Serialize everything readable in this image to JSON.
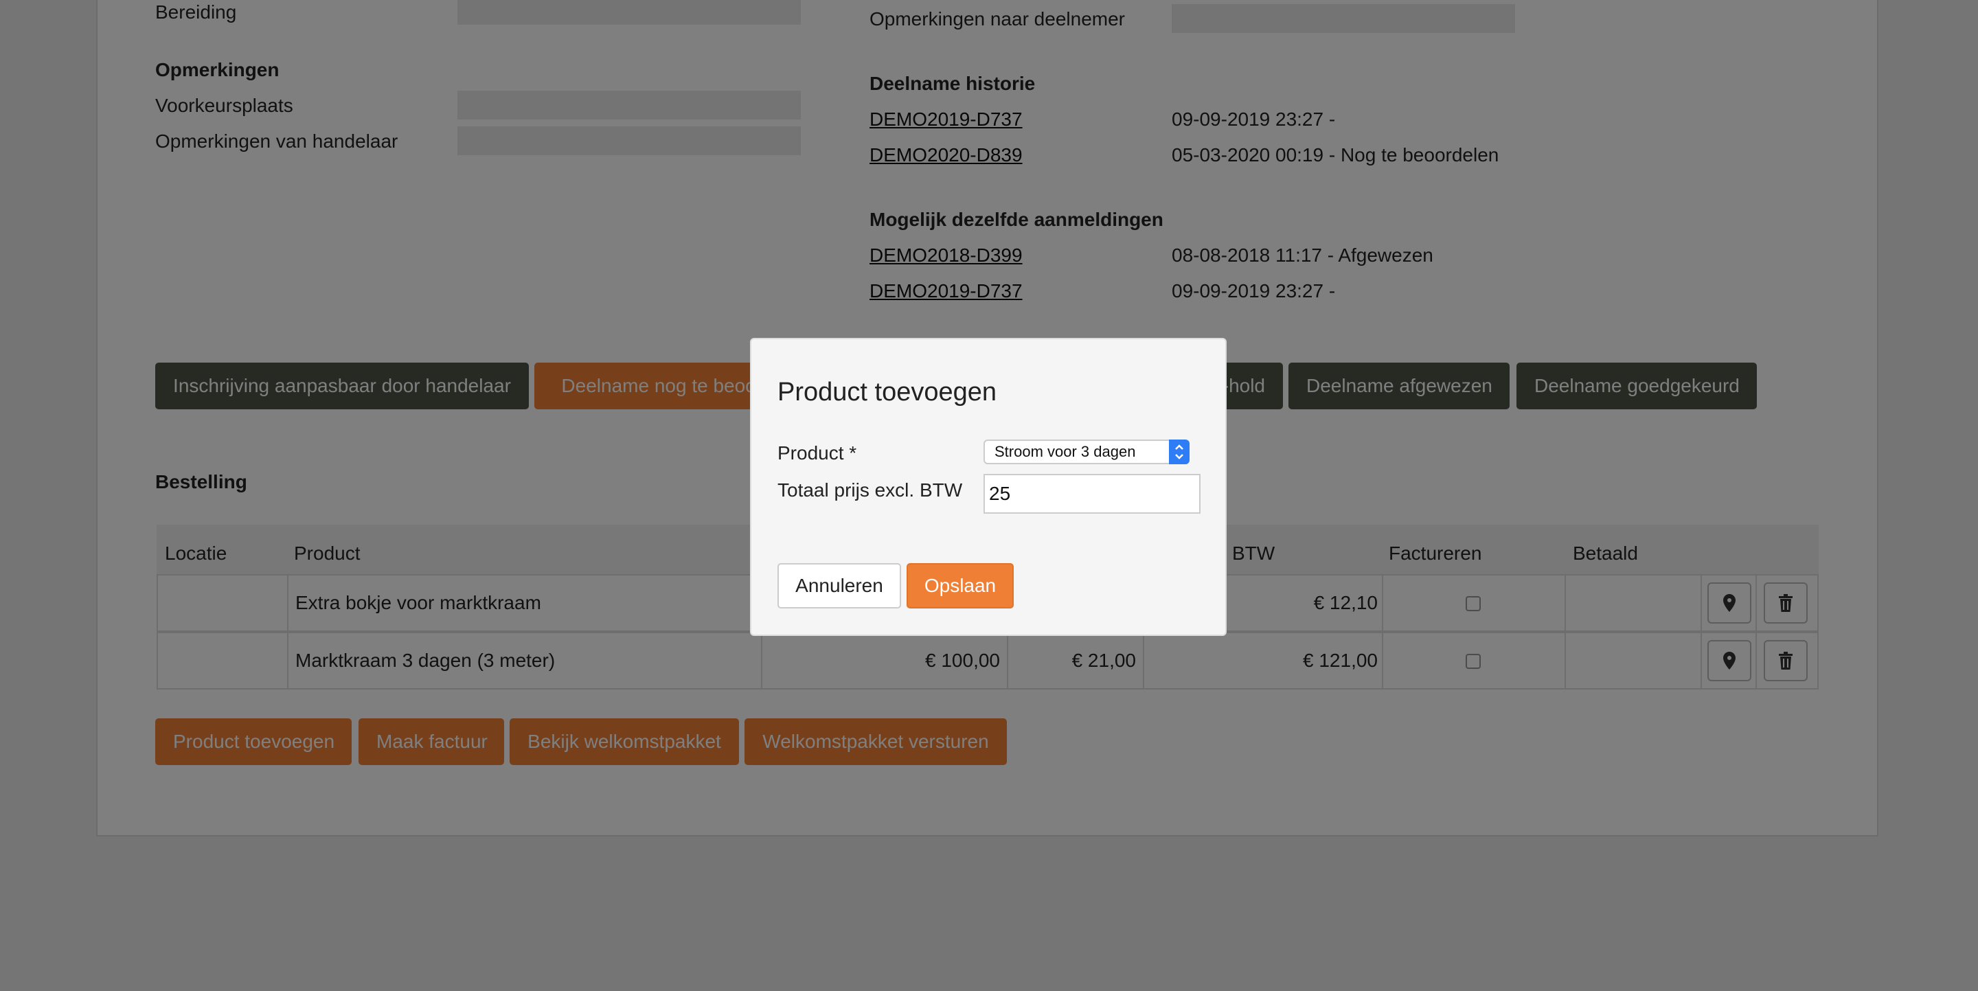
{
  "left_section": {
    "bereiding_label": "Bereiding",
    "opmerkingen_heading": "Opmerkingen",
    "voorkeursplaats_label": "Voorkeursplaats",
    "opm_handelaar_label": "Opmerkingen van handelaar"
  },
  "right_section": {
    "opm_deelnemer_label": "Opmerkingen naar deelnemer",
    "historie_heading": "Deelname historie",
    "historie": [
      {
        "code": "DEMO2019-D737",
        "info": "09-09-2019 23:27 -"
      },
      {
        "code": "DEMO2020-D839",
        "info": "05-03-2020 00:19 - Nog te beoordelen"
      }
    ],
    "mogelijk_heading": "Mogelijk dezelfde aanmeldingen",
    "mogelijk": [
      {
        "code": "DEMO2018-D399",
        "info": "08-08-2018 11:17 - Afgewezen"
      },
      {
        "code": "DEMO2019-D737",
        "info": "09-09-2019 23:27 -"
      }
    ]
  },
  "status_buttons": {
    "aanpasbaar": "Inschrijving aanpasbaar door handelaar",
    "nog_te_beoordelen": "Deelname nog te beoordelen",
    "on_hold": "Deelname on-hold",
    "afgewezen": "Deelname afgewezen",
    "goedgekeurd": "Deelname goedgekeurd"
  },
  "bestelling": {
    "heading": "Bestelling",
    "columns": {
      "locatie": "Locatie",
      "product": "Product",
      "btw": "BTW",
      "factureren": "Factureren",
      "betaald": "Betaald"
    },
    "rows": [
      {
        "product": "Extra bokje voor marktkraam",
        "price": "",
        "vat": "",
        "total": "€ 12,10"
      },
      {
        "product": "Marktkraam 3 dagen (3 meter)",
        "price": "€ 100,00",
        "vat": "€ 21,00",
        "total": "€ 121,00"
      }
    ]
  },
  "action_buttons": {
    "product_toevoegen": "Product toevoegen",
    "maak_factuur": "Maak factuur",
    "bekijk_welkomstpakket": "Bekijk welkomstpakket",
    "welkomstpakket_versturen": "Welkomstpakket versturen"
  },
  "modal": {
    "title": "Product toevoegen",
    "product_label": "Product *",
    "product_value": "Stroom voor 3 dagen",
    "price_label": "Totaal prijs excl. BTW",
    "price_value": "25",
    "cancel": "Annuleren",
    "save": "Opslaan"
  },
  "colors": {
    "accent_orange": "#ee7f35",
    "dark_button": "#4c5546",
    "select_arrow": "#2f7df6"
  }
}
